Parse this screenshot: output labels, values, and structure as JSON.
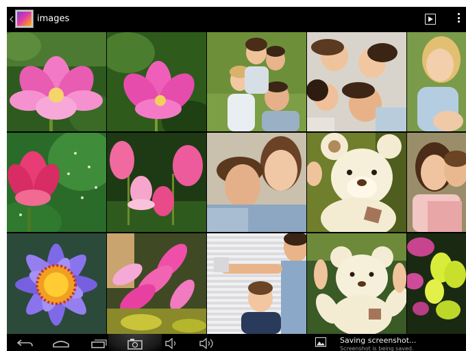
{
  "action_bar": {
    "title": "images",
    "app_icon": "gallery-app-icon",
    "actions": [
      {
        "icon": "slideshow-icon"
      },
      {
        "icon": "overflow-menu-icon"
      }
    ]
  },
  "grid": {
    "photos": [
      {
        "subject": "pink-lotus-flower"
      },
      {
        "subject": "pink-lotus-flower"
      },
      {
        "subject": "family-group-portrait"
      },
      {
        "subject": "family-lying-on-floor"
      },
      {
        "subject": "smiling-girls"
      },
      {
        "subject": "pink-lotus-with-dew-leaves"
      },
      {
        "subject": "pink-lotus-pond"
      },
      {
        "subject": "couple-portrait"
      },
      {
        "subject": "teddy-bear"
      },
      {
        "subject": "smiling-women"
      },
      {
        "subject": "purple-water-lily"
      },
      {
        "subject": "pink-flowering-shrub"
      },
      {
        "subject": "father-and-son"
      },
      {
        "subject": "teddy-bear-held"
      },
      {
        "subject": "yellow-orchids"
      }
    ]
  },
  "nav_bar": {
    "buttons": [
      {
        "icon": "back-icon"
      },
      {
        "icon": "home-icon"
      },
      {
        "icon": "recent-apps-icon"
      },
      {
        "icon": "screenshot-icon"
      },
      {
        "icon": "volume-down-icon"
      },
      {
        "icon": "volume-up-icon"
      }
    ]
  },
  "notification": {
    "icon": "image-icon",
    "title": "Saving screenshot...",
    "subtitle": "Screenshot is being saved."
  }
}
